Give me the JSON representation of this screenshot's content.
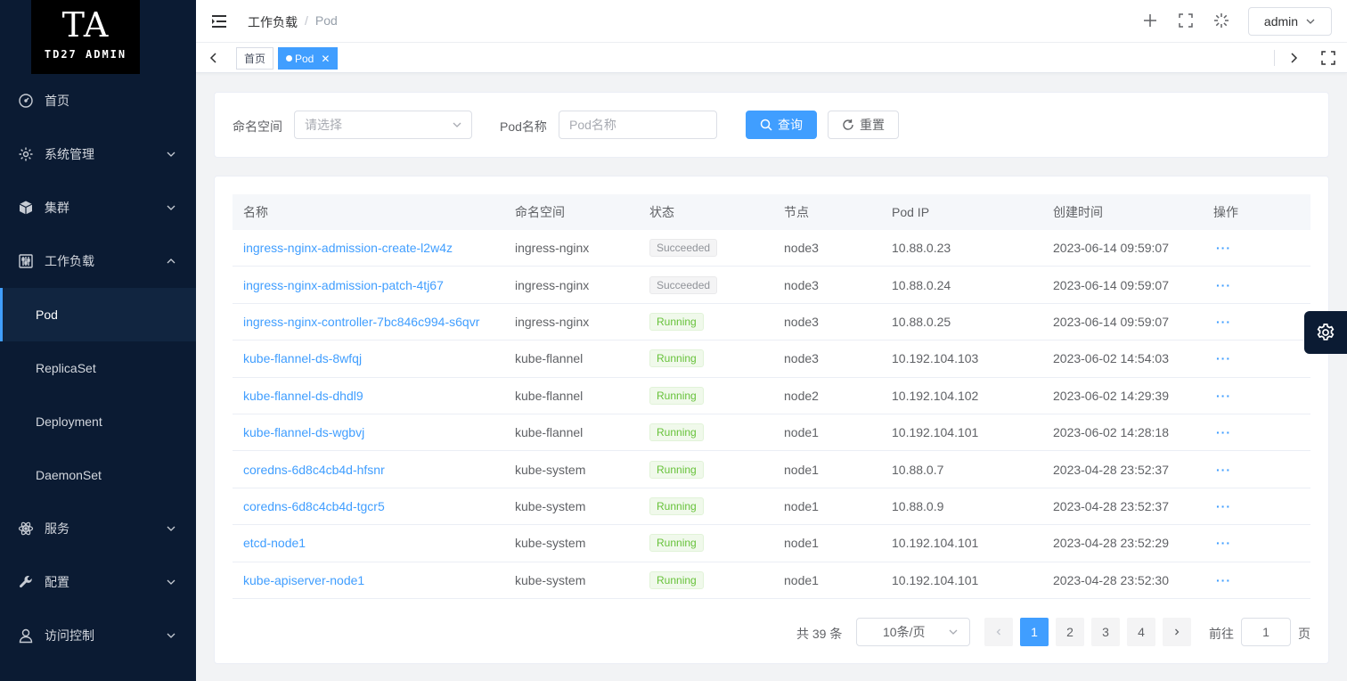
{
  "logo": {
    "big": "TA",
    "small": "TD27 ADMIN"
  },
  "sidebar": {
    "items": [
      {
        "label": "首页",
        "icon": "dashboard-icon"
      },
      {
        "label": "系统管理",
        "icon": "gear-icon",
        "expanded": false
      },
      {
        "label": "集群",
        "icon": "cube-icon",
        "expanded": false
      },
      {
        "label": "工作负载",
        "icon": "sliders-icon",
        "expanded": true,
        "children": [
          {
            "label": "Pod",
            "active": true
          },
          {
            "label": "ReplicaSet"
          },
          {
            "label": "Deployment"
          },
          {
            "label": "DaemonSet"
          }
        ]
      },
      {
        "label": "服务",
        "icon": "atom-icon",
        "expanded": false
      },
      {
        "label": "配置",
        "icon": "wrench-icon",
        "expanded": false
      },
      {
        "label": "访问控制",
        "icon": "user-icon",
        "expanded": false
      }
    ]
  },
  "header": {
    "breadcrumb": [
      "工作负载",
      "Pod"
    ],
    "separator": "/",
    "user": "admin"
  },
  "tabs": [
    {
      "label": "首页",
      "active": false
    },
    {
      "label": "Pod",
      "active": true
    }
  ],
  "search": {
    "namespace_label": "命名空间",
    "namespace_placeholder": "请选择",
    "podname_label": "Pod名称",
    "podname_placeholder": "Pod名称",
    "query_btn": "查询",
    "reset_btn": "重置"
  },
  "table": {
    "columns": [
      "名称",
      "命名空间",
      "状态",
      "节点",
      "Pod IP",
      "创建时间",
      "操作"
    ],
    "rows": [
      {
        "name": "ingress-nginx-admission-create-l2w4z",
        "namespace": "ingress-nginx",
        "status": "Succeeded",
        "node": "node3",
        "ip": "10.88.0.23",
        "created": "2023-06-14 09:59:07",
        "action": "···"
      },
      {
        "name": "ingress-nginx-admission-patch-4tj67",
        "namespace": "ingress-nginx",
        "status": "Succeeded",
        "node": "node3",
        "ip": "10.88.0.24",
        "created": "2023-06-14 09:59:07",
        "action": "···"
      },
      {
        "name": "ingress-nginx-controller-7bc846c994-s6qvr",
        "namespace": "ingress-nginx",
        "status": "Running",
        "node": "node3",
        "ip": "10.88.0.25",
        "created": "2023-06-14 09:59:07",
        "action": "···"
      },
      {
        "name": "kube-flannel-ds-8wfqj",
        "namespace": "kube-flannel",
        "status": "Running",
        "node": "node3",
        "ip": "10.192.104.103",
        "created": "2023-06-02 14:54:03",
        "action": "···"
      },
      {
        "name": "kube-flannel-ds-dhdl9",
        "namespace": "kube-flannel",
        "status": "Running",
        "node": "node2",
        "ip": "10.192.104.102",
        "created": "2023-06-02 14:29:39",
        "action": "···"
      },
      {
        "name": "kube-flannel-ds-wgbvj",
        "namespace": "kube-flannel",
        "status": "Running",
        "node": "node1",
        "ip": "10.192.104.101",
        "created": "2023-06-02 14:28:18",
        "action": "···"
      },
      {
        "name": "coredns-6d8c4cb4d-hfsnr",
        "namespace": "kube-system",
        "status": "Running",
        "node": "node1",
        "ip": "10.88.0.7",
        "created": "2023-04-28 23:52:37",
        "action": "···"
      },
      {
        "name": "coredns-6d8c4cb4d-tgcr5",
        "namespace": "kube-system",
        "status": "Running",
        "node": "node1",
        "ip": "10.88.0.9",
        "created": "2023-04-28 23:52:37",
        "action": "···"
      },
      {
        "name": "etcd-node1",
        "namespace": "kube-system",
        "status": "Running",
        "node": "node1",
        "ip": "10.192.104.101",
        "created": "2023-04-28 23:52:29",
        "action": "···"
      },
      {
        "name": "kube-apiserver-node1",
        "namespace": "kube-system",
        "status": "Running",
        "node": "node1",
        "ip": "10.192.104.101",
        "created": "2023-04-28 23:52:30",
        "action": "···"
      }
    ]
  },
  "pagination": {
    "total": "共 39 条",
    "page_size": "10条/页",
    "pages": [
      "1",
      "2",
      "3",
      "4"
    ],
    "current": "1",
    "goto_label": "前往",
    "goto_value": "1",
    "goto_unit": "页"
  },
  "colors": {
    "primary": "#409eff",
    "sidebar": "#0b1b33",
    "running": "#67c23a",
    "succeeded": "#909399"
  }
}
